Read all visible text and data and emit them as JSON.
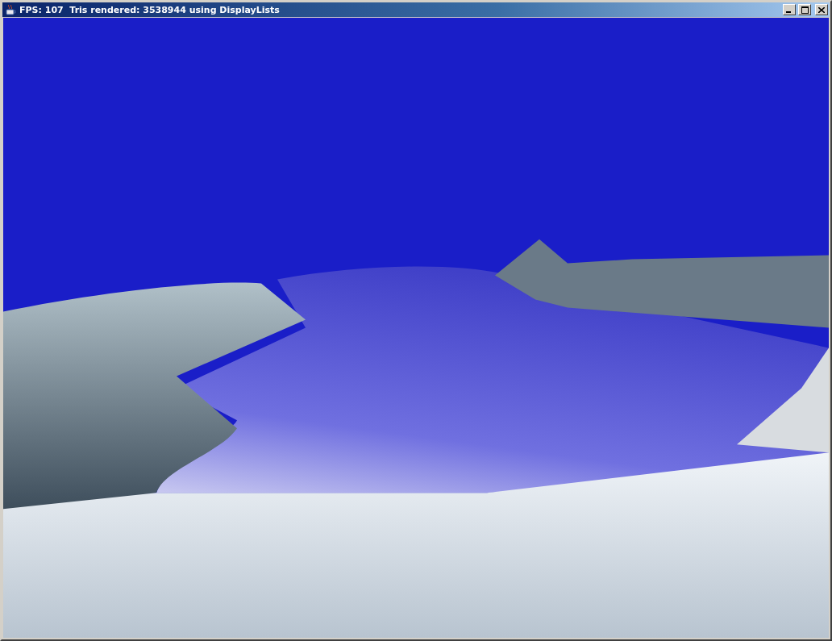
{
  "window": {
    "title": "FPS: 107  Tris rendered: 3538944 using DisplayLists"
  }
}
